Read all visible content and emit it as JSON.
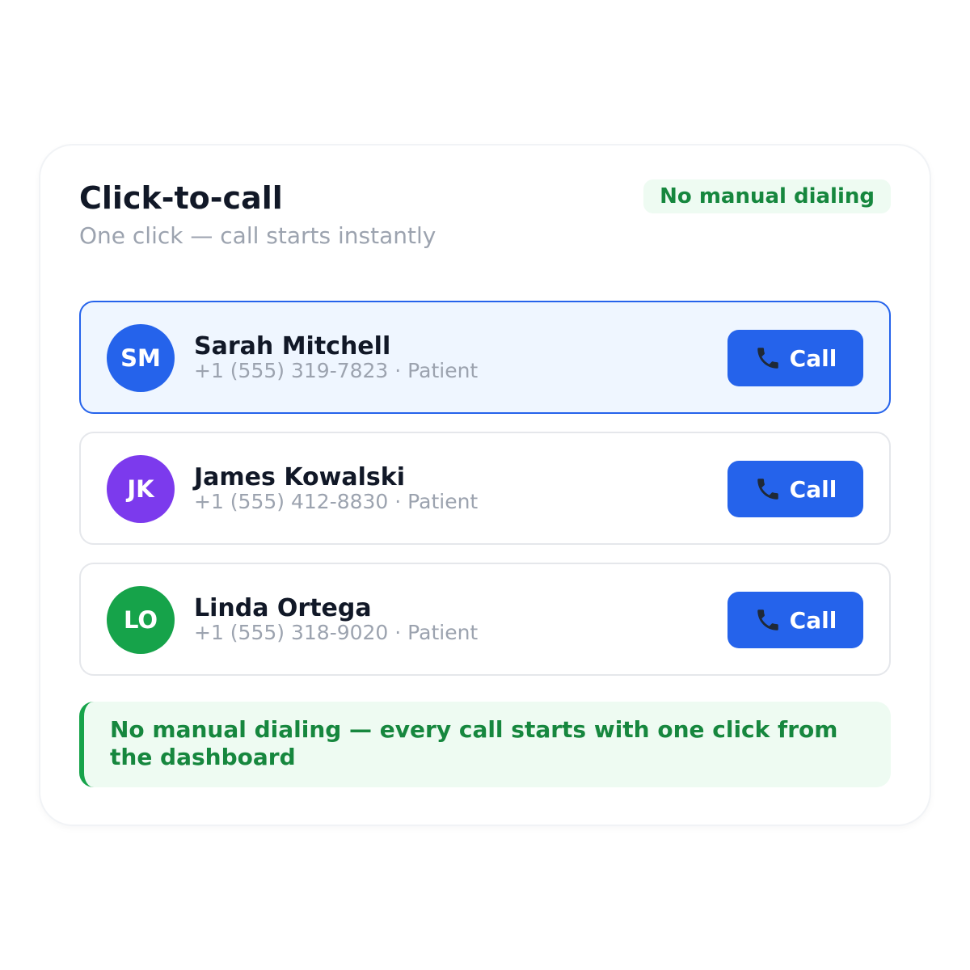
{
  "header": {
    "title": "Click-to-call",
    "subtitle": "One click — call starts instantly",
    "badge": "No manual dialing"
  },
  "contacts": [
    {
      "initials": "SM",
      "name": "Sarah Mitchell",
      "meta": "+1 (555) 319-7823 · Patient",
      "avatar_color": "#2563eb",
      "selected": true,
      "call_label": "Call"
    },
    {
      "initials": "JK",
      "name": "James Kowalski",
      "meta": "+1 (555) 412-8830 · Patient",
      "avatar_color": "#7c3aed",
      "selected": false,
      "call_label": "Call"
    },
    {
      "initials": "LO",
      "name": "Linda Ortega",
      "meta": "+1 (555) 318-9020 · Patient",
      "avatar_color": "#16a34a",
      "selected": false,
      "call_label": "Call"
    }
  ],
  "footer": {
    "note": "No manual dialing — every call starts with one click from the dashboard"
  },
  "colors": {
    "accent": "#2563eb",
    "success": "#16873e",
    "success_bg": "#eefbf2"
  },
  "icons": {
    "call_button": "phone-icon"
  }
}
